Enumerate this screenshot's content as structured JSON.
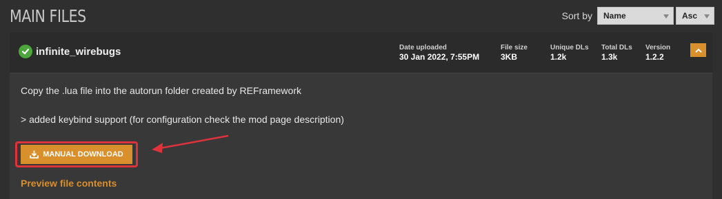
{
  "section": {
    "title": "MAIN FILES"
  },
  "sort": {
    "label": "Sort by",
    "field_value": "Name",
    "order_value": "Asc"
  },
  "file": {
    "name": "infinite_wirebugs",
    "status_icon": "check-circle-icon",
    "stats": {
      "date_label": "Date uploaded",
      "date_value": "30 Jan 2022, 7:55PM",
      "size_label": "File size",
      "size_value": "3KB",
      "unique_label": "Unique DLs",
      "unique_value": "1.2k",
      "total_label": "Total DLs",
      "total_value": "1.3k",
      "version_label": "Version",
      "version_value": "1.2.2"
    },
    "description_line1": "Copy the .lua file into the autorun folder created by REFramework",
    "description_line2": "> added keybind support (for configuration check the mod page description)",
    "download_label": "MANUAL DOWNLOAD",
    "preview_label": "Preview file contents"
  },
  "colors": {
    "accent": "#d98f2b",
    "highlight": "#e0323a",
    "success": "#4ba63c"
  }
}
